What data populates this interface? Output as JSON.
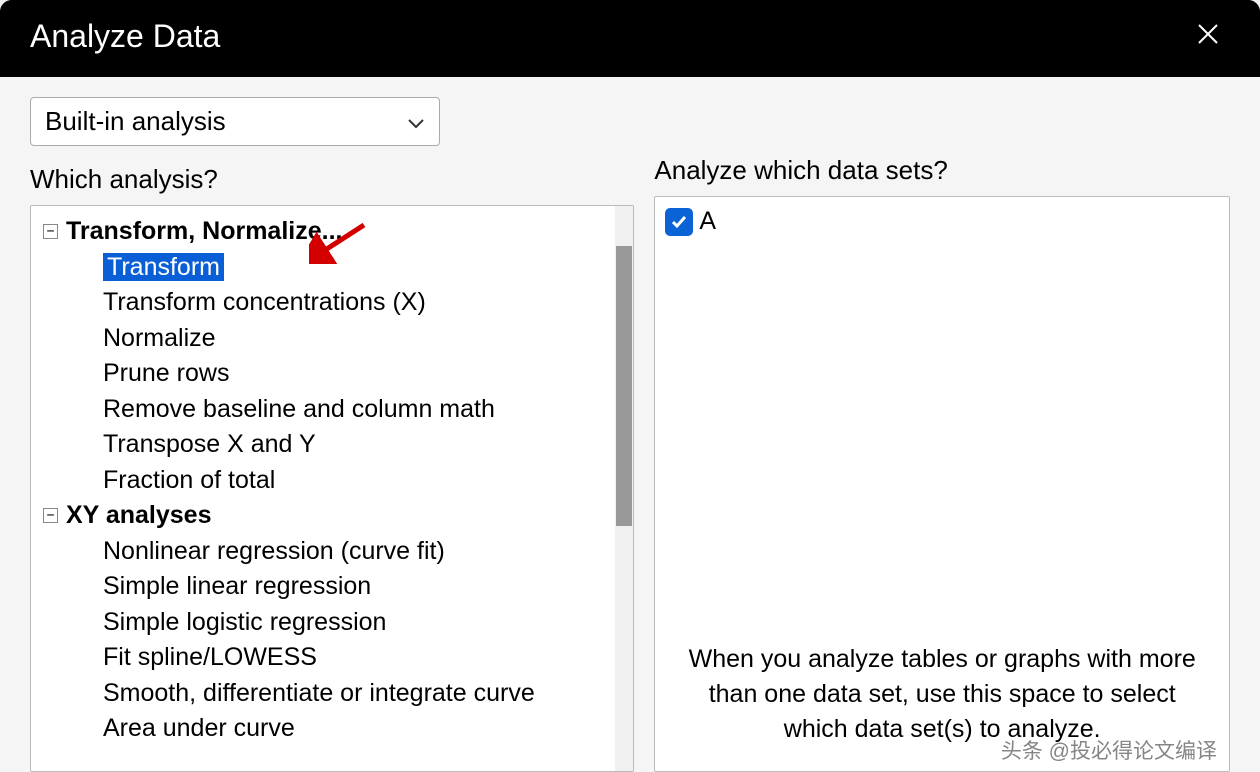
{
  "titlebar": {
    "title": "Analyze Data"
  },
  "dropdown": {
    "selected": "Built-in analysis"
  },
  "left": {
    "label": "Which analysis?",
    "groups": [
      {
        "label": "Transform, Normalize...",
        "items": [
          "Transform",
          "Transform concentrations (X)",
          "Normalize",
          "Prune rows",
          "Remove baseline and column math",
          "Transpose X and Y",
          "Fraction of total"
        ],
        "selected_index": 0
      },
      {
        "label": "XY analyses",
        "items": [
          "Nonlinear regression (curve fit)",
          "Simple linear regression",
          "Simple logistic regression",
          "Fit spline/LOWESS",
          "Smooth, differentiate or integrate curve",
          "Area under curve"
        ]
      }
    ]
  },
  "right": {
    "label": "Analyze which data sets?",
    "datasets": [
      {
        "label": "A",
        "checked": true
      }
    ],
    "hint": "When you analyze tables or graphs with more than one data set, use this space to select which data set(s) to analyze."
  },
  "watermark": "头条 @投必得论文编译"
}
